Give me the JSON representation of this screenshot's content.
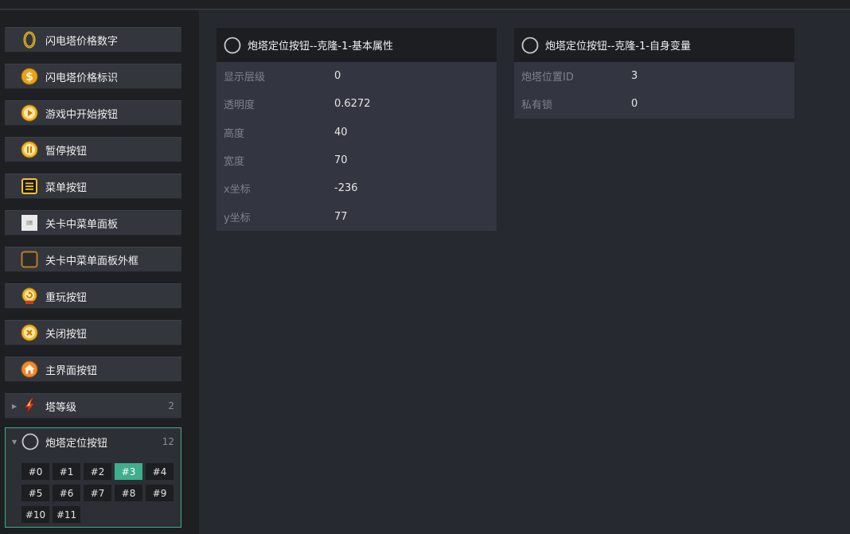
{
  "sidebar": {
    "items": [
      {
        "label": "闪电塔价格数字",
        "icon": "zero-digit-icon"
      },
      {
        "label": "闪电塔价格标识",
        "icon": "dollar-coin-icon"
      },
      {
        "label": "游戏中开始按钮",
        "icon": "play-button-icon"
      },
      {
        "label": "暂停按钮",
        "icon": "pause-button-icon"
      },
      {
        "label": "菜单按钮",
        "icon": "menu-list-icon"
      },
      {
        "label": "关卡中菜单面板",
        "icon": "panel-image-icon"
      },
      {
        "label": "关卡中菜单面板外框",
        "icon": "panel-frame-icon"
      },
      {
        "label": "重玩按钮",
        "icon": "replay-button-icon"
      },
      {
        "label": "关闭按钮",
        "icon": "close-button-icon"
      },
      {
        "label": "主界面按钮",
        "icon": "home-button-icon"
      }
    ],
    "tower_level": {
      "label": "塔等级",
      "count": "2",
      "icon": "lightning-icon"
    },
    "turret_group": {
      "label": "炮塔定位按钮",
      "count": "12",
      "icon": "circle-outline-icon",
      "chips": [
        "#0",
        "#1",
        "#2",
        "#3",
        "#4",
        "#5",
        "#6",
        "#7",
        "#8",
        "#9",
        "#10",
        "#11"
      ],
      "active_chip": "#3"
    }
  },
  "panels": {
    "basic": {
      "title": "炮塔定位按钮--克隆-1-基本属性",
      "rows": [
        {
          "key": "显示层级",
          "value": "0"
        },
        {
          "key": "透明度",
          "value": "0.6272"
        },
        {
          "key": "高度",
          "value": "40"
        },
        {
          "key": "宽度",
          "value": "70"
        },
        {
          "key": "x坐标",
          "value": "-236"
        },
        {
          "key": "y坐标",
          "value": "77"
        }
      ]
    },
    "vars": {
      "title": "炮塔定位按钮--克隆-1-自身变量",
      "rows": [
        {
          "key": "炮塔位置ID",
          "value": "3"
        },
        {
          "key": "私有锁",
          "value": "0"
        }
      ]
    }
  },
  "colors": {
    "accent": "#3fae8c",
    "background": "#26292f",
    "sidebar": "#1d1f23",
    "item": "#33363d"
  }
}
